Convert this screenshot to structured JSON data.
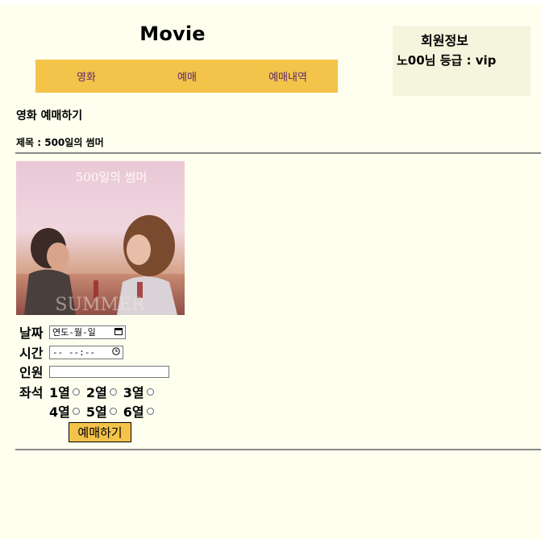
{
  "header": {
    "title": "Movie"
  },
  "nav": {
    "items": [
      "영화",
      "예매",
      "예매내역"
    ]
  },
  "member": {
    "title": "회원정보",
    "info": "노00님 등급 : vip"
  },
  "page": {
    "section_title": "영화 예매하기",
    "movie_title": "제목 : 500일의 썸머"
  },
  "poster": {
    "title_text": "500일의 썸머"
  },
  "form": {
    "date_label": "날짜",
    "date_placeholder": "연도-월-일",
    "time_label": "시간",
    "time_placeholder": "-- --:--",
    "people_label": "인원",
    "people_value": "",
    "seat_label": "좌석",
    "seats": [
      "1열",
      "2열",
      "3열",
      "4열",
      "5열",
      "6열"
    ],
    "submit_label": "예매하기"
  }
}
